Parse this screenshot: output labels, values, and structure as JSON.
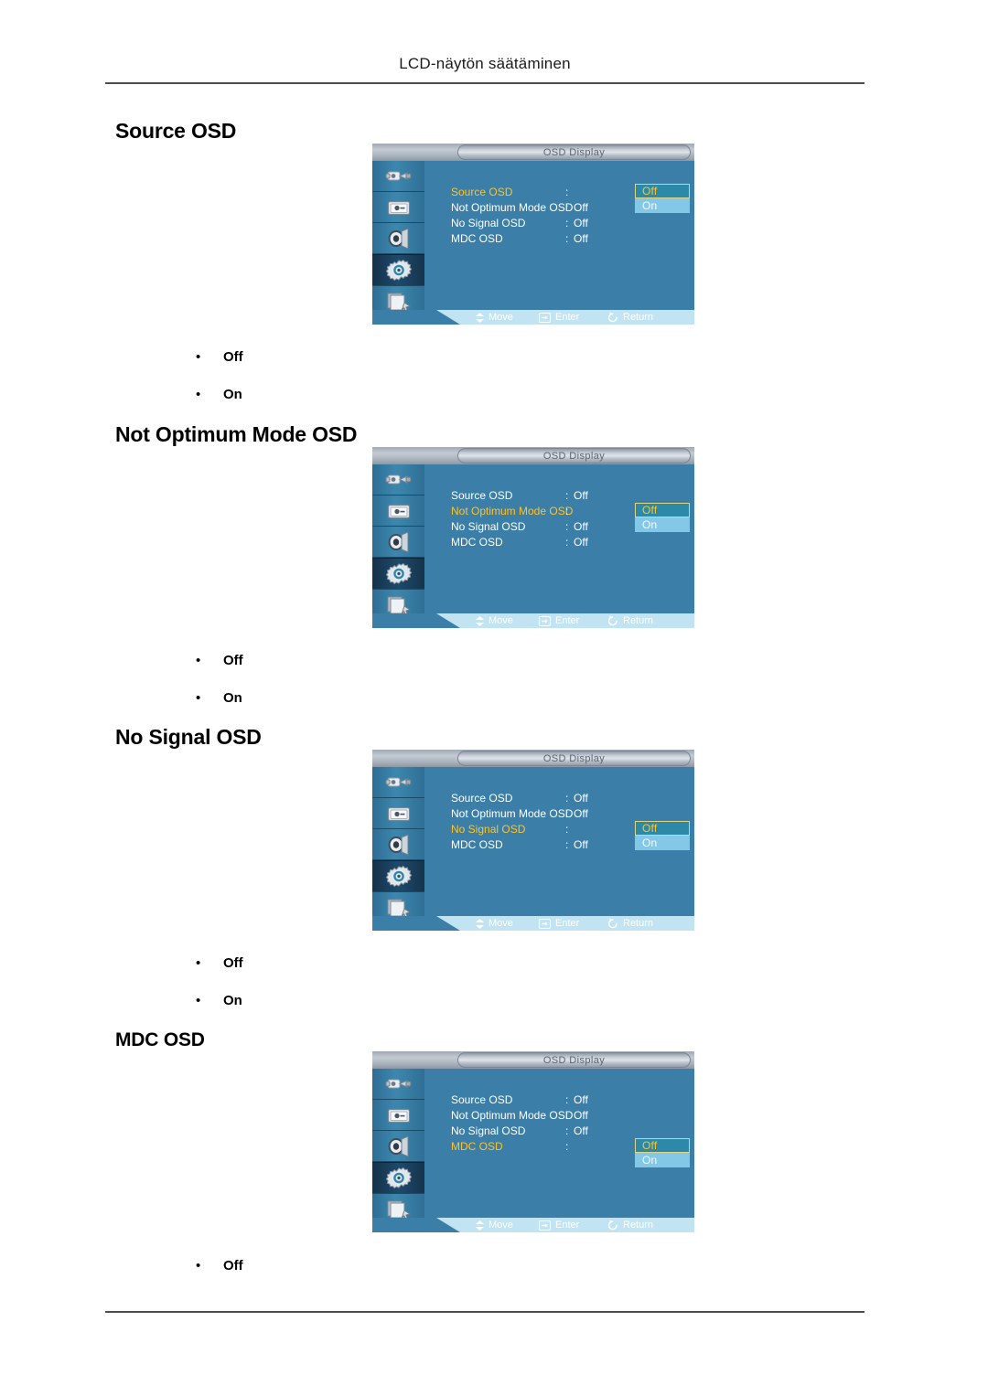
{
  "header": {
    "running_title": "LCD-näytön säätäminen"
  },
  "sections": [
    {
      "heading": "Source OSD",
      "bullets": [
        "Off",
        "On"
      ]
    },
    {
      "heading": "Not Optimum Mode OSD",
      "bullets": [
        "Off",
        "On"
      ]
    },
    {
      "heading": "No Signal OSD",
      "bullets": [
        "Off",
        "On"
      ]
    },
    {
      "heading": "MDC OSD",
      "bullets": [
        "Off"
      ]
    }
  ],
  "osd": {
    "title": "OSD Display",
    "rail_icons": [
      "input-source-icon",
      "picture-icon",
      "sound-speaker-icon",
      "setup-gear-icon",
      "multi-control-icon"
    ],
    "selected_rail_index": 3,
    "colon": ":",
    "rows": [
      "Source OSD",
      "Not Optimum Mode OSD",
      "No Signal OSD",
      "MDC OSD"
    ],
    "dropdown_options": [
      "Off",
      "On"
    ],
    "hints": [
      {
        "icon": "move-diamond-icon",
        "label": "Move"
      },
      {
        "icon": "enter-icon",
        "label": "Enter"
      },
      {
        "icon": "return-icon",
        "label": "Return"
      }
    ],
    "menus": [
      {
        "active_index": 0,
        "values": [
          "Off",
          "Off",
          "Off",
          "Off"
        ],
        "dropdown_selected": "Off"
      },
      {
        "active_index": 1,
        "values": [
          "Off",
          "Off",
          "Off",
          "Off"
        ],
        "dropdown_selected": "Off"
      },
      {
        "active_index": 2,
        "values": [
          "Off",
          "Off",
          "Off",
          "Off"
        ],
        "dropdown_selected": "Off"
      },
      {
        "active_index": 3,
        "values": [
          "Off",
          "Off",
          "Off",
          "Off"
        ],
        "dropdown_selected": "Off"
      }
    ]
  },
  "colors": {
    "osd_body": "#3b7fa8",
    "highlight_text": "#ffc226",
    "dropdown_unselected": "#84c8e8",
    "hint_bar": "#c2e4f2"
  }
}
